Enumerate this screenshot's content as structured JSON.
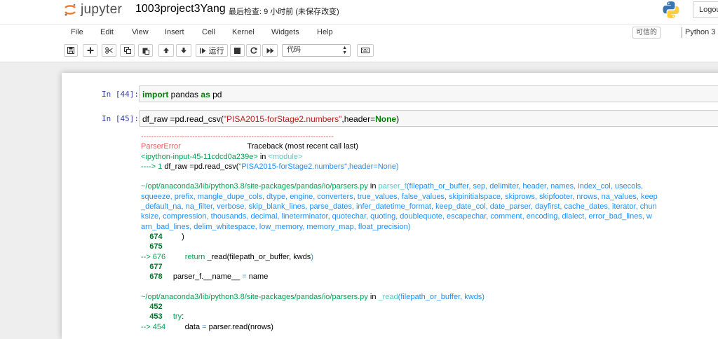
{
  "header": {
    "logo_text": "jupyter",
    "notebook_name": "1003project3Yang",
    "checkpoint": "最后检查: 9 小时前  (未保存改变)",
    "logout_label": "Logout"
  },
  "menubar": {
    "items": [
      "File",
      "Edit",
      "View",
      "Insert",
      "Cell",
      "Kernel",
      "Widgets",
      "Help"
    ],
    "trusted": "可信的",
    "kernel": "Python 3"
  },
  "toolbar": {
    "run_label": "运行",
    "cell_type": "代码"
  },
  "cells": [
    {
      "prompt": "In [44]:",
      "tokens": [
        {
          "t": "import",
          "c": "kw"
        },
        {
          "t": " pandas ",
          "c": ""
        },
        {
          "t": "as",
          "c": "kw"
        },
        {
          "t": " pd",
          "c": ""
        }
      ]
    },
    {
      "prompt": "In [45]:",
      "tokens": [
        {
          "t": "df_raw ",
          "c": ""
        },
        {
          "t": "=",
          "c": ""
        },
        {
          "t": "pd.read_csv(",
          "c": ""
        },
        {
          "t": "\"PISA2015-forStage2.numbers\"",
          "c": "str"
        },
        {
          "t": ",header",
          "c": ""
        },
        {
          "t": "=",
          "c": ""
        },
        {
          "t": "None",
          "c": "kw"
        },
        {
          "t": ")",
          "c": ""
        }
      ]
    }
  ],
  "traceback": [
    [
      {
        "t": "---------------------------------------------------------------------------",
        "c": "red"
      }
    ],
    [
      {
        "t": "ParserError",
        "c": "red"
      },
      {
        "t": "                               Traceback (most recent call last)",
        "c": ""
      }
    ],
    [
      {
        "t": "<ipython-input-45-11cdcd0a239e>",
        "c": "green"
      },
      {
        "t": " in ",
        "c": ""
      },
      {
        "t": "<module>",
        "c": "cyan"
      }
    ],
    [
      {
        "t": "----> 1 ",
        "c": "green"
      },
      {
        "t": "df_raw =pd.read_csv(",
        "c": ""
      },
      {
        "t": "\"PISA2015-forStage2.numbers\"",
        "c": "blue"
      },
      {
        "t": ",header=None)",
        "c": "blue"
      }
    ],
    [
      {
        "t": "",
        "c": ""
      }
    ],
    [
      {
        "t": "~/opt/anaconda3/lib/python3.8/site-packages/pandas/io/parsers.py",
        "c": "green"
      },
      {
        "t": " in ",
        "c": ""
      },
      {
        "t": "parser_f",
        "c": "cyan"
      },
      {
        "t": "(filepath_or_buffer, sep, delimiter, header, names, index_col, usecols,",
        "c": "blue"
      }
    ],
    [
      {
        "t": "squeeze, prefix, mangle_dupe_cols, dtype, engine, converters, true_values, false_values, skipinitialspace, skiprows, skipfooter, nrows, na_values, keep",
        "c": "blue"
      }
    ],
    [
      {
        "t": "_default_na, na_filter, verbose, skip_blank_lines, parse_dates, infer_datetime_format, keep_date_col, date_parser, dayfirst, cache_dates, iterator, chun",
        "c": "blue"
      }
    ],
    [
      {
        "t": "ksize, compression, thousands, decimal, lineterminator, quotechar, quoting, doublequote, escapechar, comment, encoding, dialect, error_bad_lines, w",
        "c": "blue"
      }
    ],
    [
      {
        "t": "arn_bad_lines, delim_whitespace, low_memory, memory_map, float_precision)",
        "c": "blue"
      }
    ],
    [
      {
        "t": "    674",
        "c": "dkgreen"
      },
      {
        "t": "         )",
        "c": ""
      }
    ],
    [
      {
        "t": "    675",
        "c": "dkgreen"
      }
    ],
    [
      {
        "t": "--> 676",
        "c": "green"
      },
      {
        "t": "         ",
        "c": ""
      },
      {
        "t": "return",
        "c": "green"
      },
      {
        "t": " _read(filepath_or_buffer, kwds",
        "c": ""
      },
      {
        "t": ")",
        "c": "blue"
      }
    ],
    [
      {
        "t": "    677",
        "c": "dkgreen"
      }
    ],
    [
      {
        "t": "    678",
        "c": "dkgreen"
      },
      {
        "t": "     parser_f.__name__ ",
        "c": ""
      },
      {
        "t": "=",
        "c": "blue"
      },
      {
        "t": " name",
        "c": ""
      }
    ],
    [
      {
        "t": "",
        "c": ""
      }
    ],
    [
      {
        "t": "~/opt/anaconda3/lib/python3.8/site-packages/pandas/io/parsers.py",
        "c": "green"
      },
      {
        "t": " in ",
        "c": ""
      },
      {
        "t": "_read",
        "c": "cyan"
      },
      {
        "t": "(filepath_or_buffer, kwds)",
        "c": "blue"
      }
    ],
    [
      {
        "t": "    452",
        "c": "dkgreen"
      }
    ],
    [
      {
        "t": "    453",
        "c": "dkgreen"
      },
      {
        "t": "     ",
        "c": ""
      },
      {
        "t": "try",
        "c": "green"
      },
      {
        "t": ":",
        "c": ""
      }
    ],
    [
      {
        "t": "--> 454",
        "c": "green"
      },
      {
        "t": "         data ",
        "c": ""
      },
      {
        "t": "=",
        "c": "blue"
      },
      {
        "t": " parser.read(nrows)",
        "c": ""
      }
    ]
  ]
}
